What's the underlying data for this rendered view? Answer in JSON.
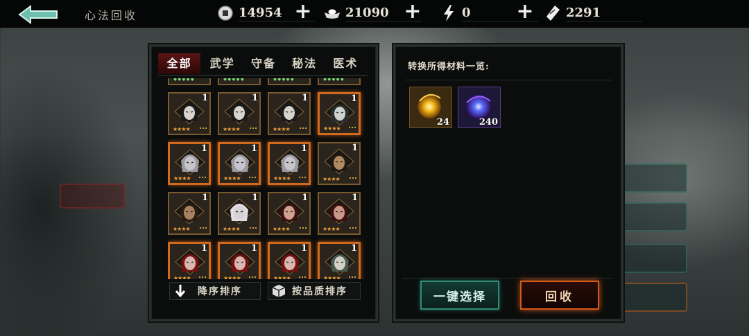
{
  "header": {
    "title": "心法回收",
    "resources": [
      {
        "icon": "coin-icon",
        "value": "14954"
      },
      {
        "icon": "silver-ingot-icon",
        "value": "21090"
      },
      {
        "icon": "lightning-icon",
        "value": "0"
      },
      {
        "icon": "ticket-icon",
        "value": "2291"
      }
    ]
  },
  "tabs": [
    {
      "label": "全部",
      "active": true
    },
    {
      "label": "武学",
      "active": false
    },
    {
      "label": "守备",
      "active": false
    },
    {
      "label": "秘法",
      "active": false
    },
    {
      "label": "医术",
      "active": false
    }
  ],
  "cards": [
    {
      "count": "1",
      "rarity": "gold",
      "hair": "#1a1a1a",
      "skin": "#d8d3cc"
    },
    {
      "count": "1",
      "rarity": "gold",
      "hair": "#1a1a1a",
      "skin": "#d8d3cc"
    },
    {
      "count": "1",
      "rarity": "gold",
      "hair": "#1a1a1a",
      "skin": "#d8d3cc"
    },
    {
      "count": "1",
      "rarity": "orange",
      "hair": "#2a3030",
      "skin": "#cfd4cf"
    },
    {
      "count": "1",
      "rarity": "orange",
      "hair": "#9a9aa0",
      "skin": "#c8c6cc"
    },
    {
      "count": "1",
      "rarity": "orange",
      "hair": "#9a9aa0",
      "skin": "#c8c6cc"
    },
    {
      "count": "1",
      "rarity": "orange",
      "hair": "#9a9aa0",
      "skin": "#c8c6cc"
    },
    {
      "count": "1",
      "rarity": "gold",
      "hair": "#1f1a16",
      "skin": "#b08a60"
    },
    {
      "count": "1",
      "rarity": "gold",
      "hair": "#2a1c12",
      "skin": "#a88260"
    },
    {
      "count": "1",
      "rarity": "gold",
      "hair": "#e0dde0",
      "skin": "#d8d2d6"
    },
    {
      "count": "1",
      "rarity": "gold",
      "hair": "#3a1010",
      "skin": "#d0a090"
    },
    {
      "count": "1",
      "rarity": "gold",
      "hair": "#3a1010",
      "skin": "#c89888"
    },
    {
      "count": "1",
      "rarity": "orange",
      "hair": "#7a1010",
      "skin": "#d8b8b0"
    },
    {
      "count": "1",
      "rarity": "orange",
      "hair": "#7a1010",
      "skin": "#d8b8b0"
    },
    {
      "count": "1",
      "rarity": "orange",
      "hair": "#7a1010",
      "skin": "#d8b8b0"
    },
    {
      "count": "1",
      "rarity": "orange",
      "hair": "#4a5a50",
      "skin": "#d4d0c8"
    }
  ],
  "sort": {
    "desc_label": "降序排序",
    "quality_label": "按品质排序"
  },
  "materials": {
    "title": "转换所得材料一览:",
    "items": [
      {
        "icon": "gold-orb-icon",
        "qty": "24"
      },
      {
        "icon": "blue-orb-icon",
        "qty": "240"
      }
    ]
  },
  "actions": {
    "select_all": "一键选择",
    "recycle": "回收"
  }
}
